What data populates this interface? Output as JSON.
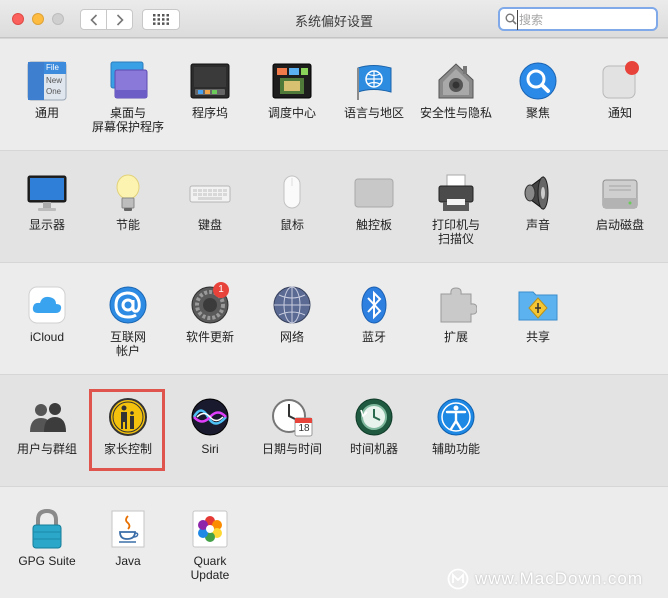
{
  "window": {
    "title": "系统偏好设置"
  },
  "search": {
    "placeholder": "搜索"
  },
  "rows": [
    {
      "items": [
        {
          "label": "通用",
          "icon": "general-icon"
        },
        {
          "label": "桌面与\n屏幕保护程序",
          "icon": "desktop-screensaver-icon"
        },
        {
          "label": "程序坞",
          "icon": "dock-icon"
        },
        {
          "label": "调度中心",
          "icon": "mission-control-icon"
        },
        {
          "label": "语言与地区",
          "icon": "language-region-icon"
        },
        {
          "label": "安全性与隐私",
          "icon": "security-privacy-icon"
        },
        {
          "label": "聚焦",
          "icon": "spotlight-icon"
        },
        {
          "label": "通知",
          "icon": "notifications-icon"
        }
      ]
    },
    {
      "items": [
        {
          "label": "显示器",
          "icon": "displays-icon"
        },
        {
          "label": "节能",
          "icon": "energy-saver-icon"
        },
        {
          "label": "键盘",
          "icon": "keyboard-icon"
        },
        {
          "label": "鼠标",
          "icon": "mouse-icon"
        },
        {
          "label": "触控板",
          "icon": "trackpad-icon"
        },
        {
          "label": "打印机与\n扫描仪",
          "icon": "printer-scanner-icon"
        },
        {
          "label": "声音",
          "icon": "sound-icon"
        },
        {
          "label": "启动磁盘",
          "icon": "startup-disk-icon"
        }
      ]
    },
    {
      "items": [
        {
          "label": "iCloud",
          "icon": "icloud-icon"
        },
        {
          "label": "互联网\n帐户",
          "icon": "internet-accounts-icon"
        },
        {
          "label": "软件更新",
          "icon": "software-update-icon",
          "badge": "1"
        },
        {
          "label": "网络",
          "icon": "network-icon"
        },
        {
          "label": "蓝牙",
          "icon": "bluetooth-icon"
        },
        {
          "label": "扩展",
          "icon": "extensions-icon"
        },
        {
          "label": "共享",
          "icon": "sharing-icon"
        }
      ]
    },
    {
      "items": [
        {
          "label": "用户与群组",
          "icon": "users-groups-icon"
        },
        {
          "label": "家长控制",
          "icon": "parental-controls-icon"
        },
        {
          "label": "Siri",
          "icon": "siri-icon"
        },
        {
          "label": "日期与时间",
          "icon": "date-time-icon",
          "date_number": "18"
        },
        {
          "label": "时间机器",
          "icon": "time-machine-icon"
        },
        {
          "label": "辅助功能",
          "icon": "accessibility-icon"
        }
      ]
    },
    {
      "items": [
        {
          "label": "GPG Suite",
          "icon": "gpg-suite-icon"
        },
        {
          "label": "Java",
          "icon": "java-icon"
        },
        {
          "label": "Quark\nUpdate",
          "icon": "quark-update-icon"
        }
      ]
    }
  ],
  "general_icon_text": [
    "File",
    "New",
    "One"
  ],
  "watermark": {
    "text": "www.MacDown.com",
    "icon": "macdown-logo-icon"
  },
  "colors": {
    "highlight": "#e0544e",
    "search_focus": "#7fa9e8",
    "badge": "#e8433b"
  }
}
